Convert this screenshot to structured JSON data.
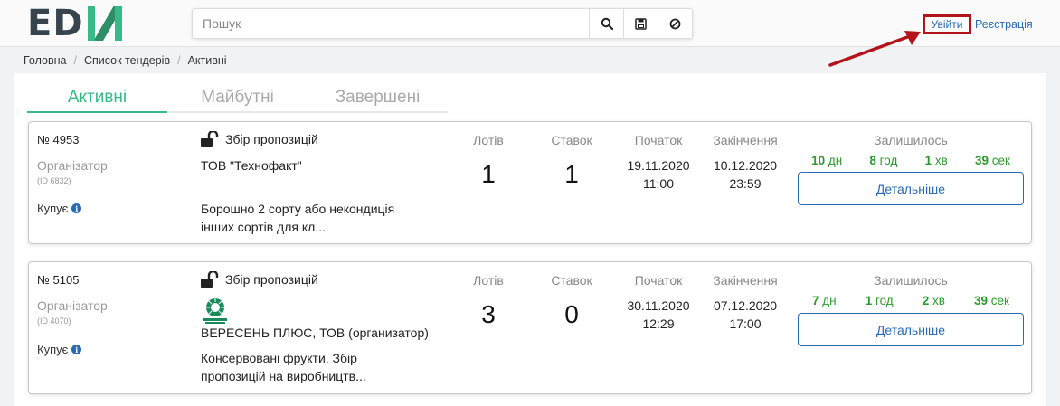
{
  "header": {
    "logo_text": "EDIN",
    "search": {
      "placeholder": "Пошук",
      "value": ""
    },
    "login_label": "Увійти",
    "register_label": "Реєстрація"
  },
  "breadcrumb": [
    "Головна",
    "Список тендерів",
    "Активні"
  ],
  "tabs": [
    {
      "label": "Активні",
      "active": true
    },
    {
      "label": "Майбутні",
      "active": false
    },
    {
      "label": "Завершені",
      "active": false
    }
  ],
  "columns": {
    "lots": "Лотів",
    "bids": "Ставок",
    "start": "Початок",
    "end": "Закінчення",
    "remaining": "Залишилось",
    "organizer": "Організатор",
    "buys": "Купує",
    "details": "Детальніше"
  },
  "tenders": [
    {
      "number": "№ 4953",
      "org_id": "(ID 6832)",
      "status": "Збір пропозицій",
      "company": "ТОВ \"Технофакт\"",
      "description_line1": "Борошно 2 сорту або некондиція",
      "description_line2": "інших сортів для кл...",
      "lots": "1",
      "bids": "1",
      "start_date": "19.11.2020",
      "start_time": "11:00",
      "end_date": "10.12.2020",
      "end_time": "23:59",
      "timer": {
        "days": "10",
        "days_unit": "дн",
        "hours": "8",
        "hours_unit": "год",
        "minutes": "1",
        "minutes_unit": "хв",
        "seconds": "39",
        "seconds_unit": "сек"
      }
    },
    {
      "number": "№ 5105",
      "org_id": "(ID 4070)",
      "status": "Збір пропозицій",
      "company": "ВЕРЕСЕНЬ ПЛЮС, ТОВ (организатор)",
      "description_line1": "Консервовані фрукти. Збір",
      "description_line2": "пропозицій на виробництв...",
      "lots": "3",
      "bids": "0",
      "start_date": "30.11.2020",
      "start_time": "12:29",
      "end_date": "07.12.2020",
      "end_time": "17:00",
      "timer": {
        "days": "7",
        "days_unit": "дн",
        "hours": "1",
        "hours_unit": "год",
        "minutes": "2",
        "minutes_unit": "хв",
        "seconds": "39",
        "seconds_unit": "сек"
      }
    }
  ],
  "colors": {
    "accent": "#37b98a",
    "link": "#2a6ab0",
    "timer_green": "#2e9a2e",
    "highlight_red": "#b3141b"
  }
}
